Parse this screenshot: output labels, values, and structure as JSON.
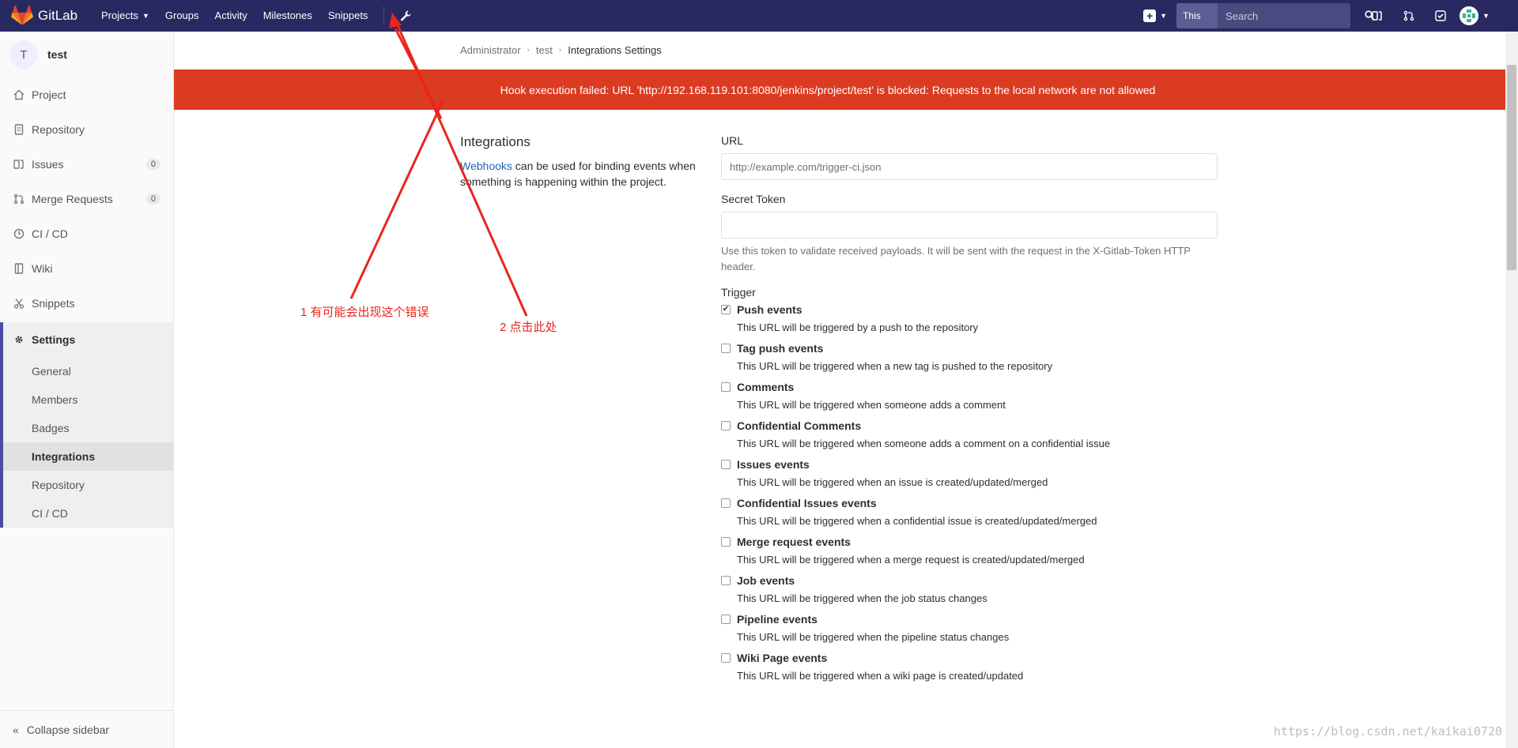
{
  "topbar": {
    "brand": "GitLab",
    "nav": [
      "Projects",
      "Groups",
      "Activity",
      "Milestones",
      "Snippets"
    ],
    "search_scope": "This project",
    "search_placeholder": "Search"
  },
  "sidebar": {
    "project_initial": "T",
    "project_name": "test",
    "items": [
      {
        "label": "Project",
        "icon": "home-icon"
      },
      {
        "label": "Repository",
        "icon": "doc-icon"
      },
      {
        "label": "Issues",
        "icon": "issues-icon",
        "badge": "0"
      },
      {
        "label": "Merge Requests",
        "icon": "merge-icon",
        "badge": "0"
      },
      {
        "label": "CI / CD",
        "icon": "rocket-icon"
      },
      {
        "label": "Wiki",
        "icon": "book-icon"
      },
      {
        "label": "Snippets",
        "icon": "scissors-icon"
      }
    ],
    "settings_label": "Settings",
    "sub_items": [
      "General",
      "Members",
      "Badges",
      "Integrations",
      "Repository",
      "CI / CD"
    ],
    "collapse_label": "Collapse sidebar"
  },
  "breadcrumb": [
    "Administrator",
    "test",
    "Integrations Settings"
  ],
  "flash": "Hook execution failed: URL 'http://192.168.119.101:8080/jenkins/project/test' is blocked: Requests to the local network are not allowed",
  "intro": {
    "title": "Integrations",
    "link": "Webhooks",
    "text": " can be used for binding events when something is happening within the project."
  },
  "form": {
    "url_label": "URL",
    "url_placeholder": "http://example.com/trigger-ci.json",
    "token_label": "Secret Token",
    "token_help": "Use this token to validate received payloads. It will be sent with the request in the X-Gitlab-Token HTTP header.",
    "trigger_label": "Trigger",
    "triggers": [
      {
        "title": "Push events",
        "desc": "This URL will be triggered by a push to the repository",
        "checked": true
      },
      {
        "title": "Tag push events",
        "desc": "This URL will be triggered when a new tag is pushed to the repository",
        "checked": false
      },
      {
        "title": "Comments",
        "desc": "This URL will be triggered when someone adds a comment",
        "checked": false
      },
      {
        "title": "Confidential Comments",
        "desc": "This URL will be triggered when someone adds a comment on a confidential issue",
        "checked": false
      },
      {
        "title": "Issues events",
        "desc": "This URL will be triggered when an issue is created/updated/merged",
        "checked": false
      },
      {
        "title": "Confidential Issues events",
        "desc": "This URL will be triggered when a confidential issue is created/updated/merged",
        "checked": false
      },
      {
        "title": "Merge request events",
        "desc": "This URL will be triggered when a merge request is created/updated/merged",
        "checked": false
      },
      {
        "title": "Job events",
        "desc": "This URL will be triggered when the job status changes",
        "checked": false
      },
      {
        "title": "Pipeline events",
        "desc": "This URL will be triggered when the pipeline status changes",
        "checked": false
      },
      {
        "title": "Wiki Page events",
        "desc": "This URL will be triggered when a wiki page is created/updated",
        "checked": false
      }
    ]
  },
  "annotations": {
    "note1": "1 有可能会出现这个错误",
    "note2": "2 点击此处"
  },
  "watermark": "https://blog.csdn.net/kaikai0720",
  "colors": {
    "nav": "#292961",
    "error": "#db3b21",
    "annotation": "#e8261d",
    "link": "#1b69b6"
  }
}
